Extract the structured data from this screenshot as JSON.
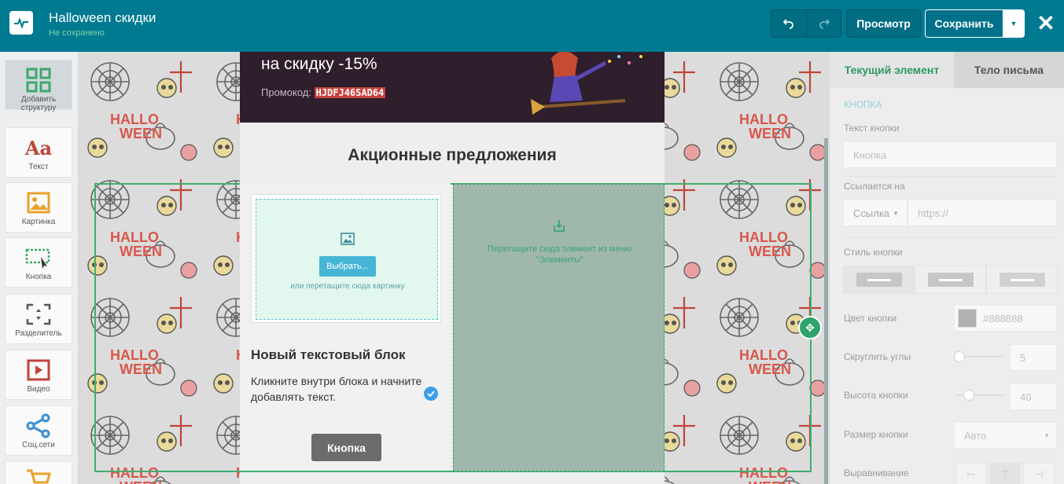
{
  "header": {
    "title": "Halloween скидки",
    "status": "Не сохранено",
    "preview_label": "Просмотр",
    "save_label": "Сохранить",
    "undo_icon": "undo-icon",
    "redo_icon": "redo-icon",
    "close_icon": "close-icon",
    "bg_color": "#007a91"
  },
  "sidebar": {
    "items": [
      {
        "label": "Добавить структуру",
        "icon": "grid-icon"
      },
      {
        "label": "Текст",
        "icon": "text-icon"
      },
      {
        "label": "Картинка",
        "icon": "image-icon"
      },
      {
        "label": "Кнопка",
        "icon": "button-icon"
      },
      {
        "label": "Разделитель",
        "icon": "divider-icon"
      },
      {
        "label": "Видео",
        "icon": "video-icon"
      },
      {
        "label": "Соц.сети",
        "icon": "share-icon"
      },
      {
        "label": "",
        "icon": "cart-icon"
      }
    ]
  },
  "email": {
    "hero_text": "на скидку -15%",
    "promo_label": "Промокод:",
    "promo_code": "HJDFJ46SAD64",
    "section_title": "Акционные предложения",
    "image_block": {
      "choose_label": "Выбрать...",
      "hint": "или перетащите сюда картинку"
    },
    "text_block": {
      "title": "Новый текстовый блок",
      "body": "Кликните внутри блока и начните добавлять текст."
    },
    "button_label": "Кнопка",
    "drop_zone_text": "Перетащите сюда элемент из меню \"Элементы\""
  },
  "panel": {
    "tabs": [
      "Текущий элемент",
      "Тело письма"
    ],
    "section": "КНОПКА",
    "button_text_label": "Текст кнопки",
    "button_text_placeholder": "Кнопка",
    "link_label": "Ссылается на",
    "link_type": "Ссылка",
    "link_placeholder": "https://",
    "style_label": "Стиль кнопки",
    "color_label": "Цвет кнопки",
    "color_value": "#888888",
    "radius_label": "Скруглить углы",
    "radius_value": "5",
    "height_label": "Высота кнопки",
    "height_value": "40",
    "size_label": "Размер кнопки",
    "size_value": "Авто",
    "align_label": "Выравнивание",
    "accent": "#2b9b63"
  }
}
